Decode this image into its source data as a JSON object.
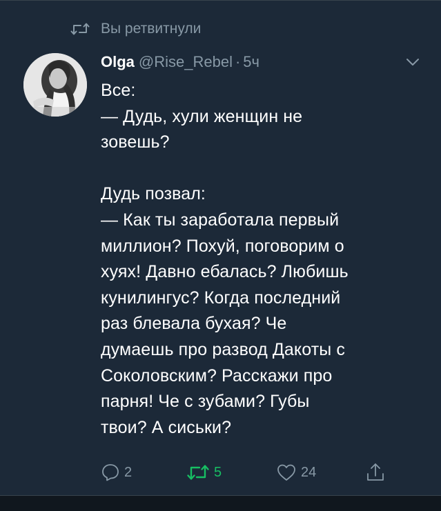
{
  "retweet_context": {
    "text": "Вы ретвитнули",
    "icon": "retweet-icon"
  },
  "author": {
    "display_name": "Olga",
    "handle": "@Rise_Rebel",
    "separator": "·",
    "time": "5ч",
    "avatar": "avatar-photo"
  },
  "tweet": {
    "text": "Все:\n— Дудь, хули женщин не\nзовешь?\n\nДудь позвал:\n— Как ты заработала первый\nмиллион? Похуй, поговорим о\nхуях! Давно ебалась? Любишь\nкунилингус? Когда последний\nраз блевала бухая? Че\nдумаешь про развод Дакоты с\nСоколовским? Расскажи про\nпарня! Че с зубами? Губы\nтвои? А сиськи?"
  },
  "actions": {
    "reply": {
      "icon": "reply-icon",
      "count": "2"
    },
    "retweet": {
      "icon": "retweet-icon",
      "count": "5",
      "active": true,
      "active_color": "#17bf63"
    },
    "like": {
      "icon": "heart-icon",
      "count": "24"
    },
    "share": {
      "icon": "share-icon"
    }
  },
  "colors": {
    "background": "#1c2938",
    "secondary_text": "#8899a6",
    "primary_text": "#ffffff",
    "retweet_active": "#17bf63"
  }
}
